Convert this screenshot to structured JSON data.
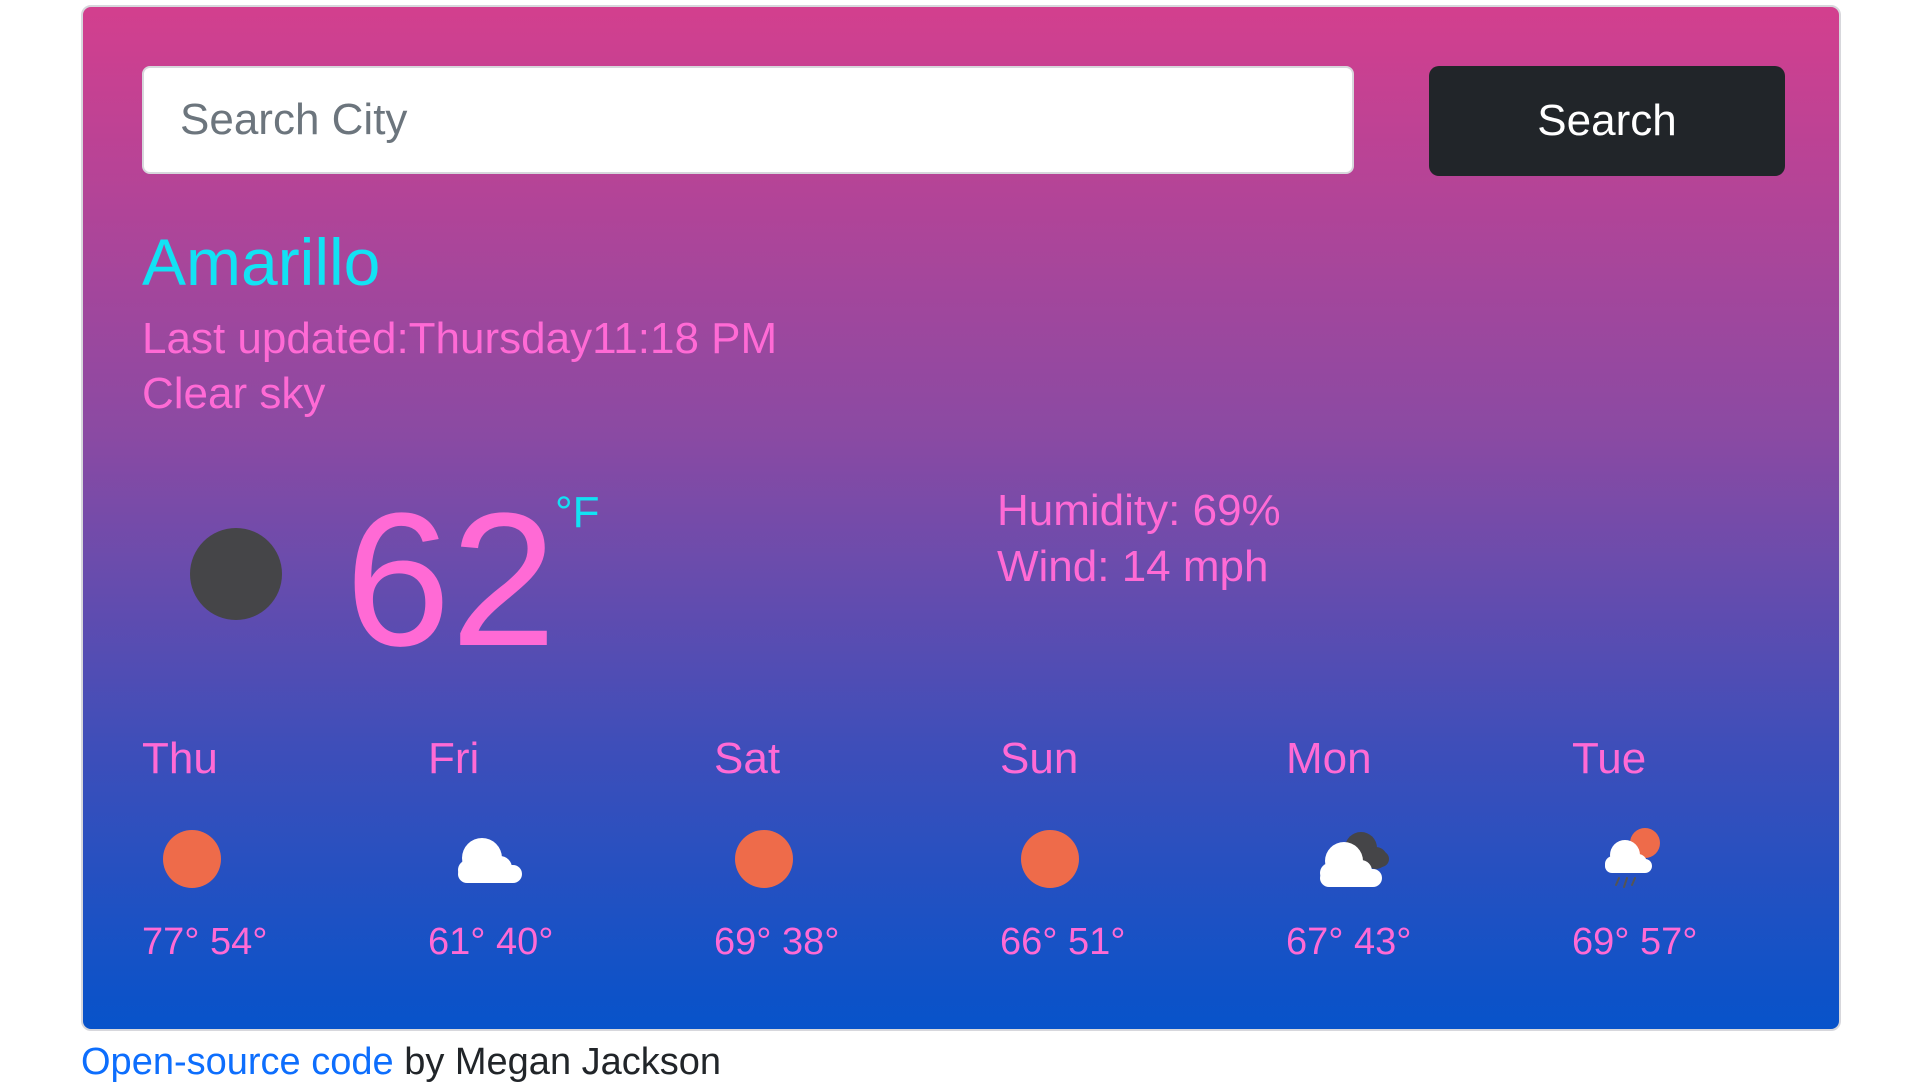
{
  "search": {
    "placeholder": "Search City",
    "value": "",
    "button_label": "Search"
  },
  "current": {
    "city": "Amarillo",
    "last_updated": "Last updated:Thursday11:18 PM",
    "description": "Clear sky",
    "icon": "clear-night-icon",
    "temperature": "62",
    "unit": "°F",
    "humidity": "Humidity: 69%",
    "wind": "Wind: 14 mph"
  },
  "forecast": [
    {
      "day": "Thu",
      "icon": "sun-icon",
      "temps": "77° 54°"
    },
    {
      "day": "Fri",
      "icon": "cloud-icon",
      "temps": "61° 40°"
    },
    {
      "day": "Sat",
      "icon": "sun-icon",
      "temps": "69° 38°"
    },
    {
      "day": "Sun",
      "icon": "sun-icon",
      "temps": "66° 51°"
    },
    {
      "day": "Mon",
      "icon": "broken-clouds-icon",
      "temps": "67° 43°"
    },
    {
      "day": "Tue",
      "icon": "sun-rain-icon",
      "temps": "69° 57°"
    }
  ],
  "footer": {
    "link_label": "Open-source code",
    "suffix": " by Megan Jackson"
  },
  "colors": {
    "accent_pink": "#ff6ad5",
    "accent_cyan": "#12e2f4",
    "button": "#212529",
    "link": "#0d6efd",
    "sun": "#ee6b4a",
    "gradient_top": "#d33f8e",
    "gradient_bottom": "#0753ca"
  }
}
